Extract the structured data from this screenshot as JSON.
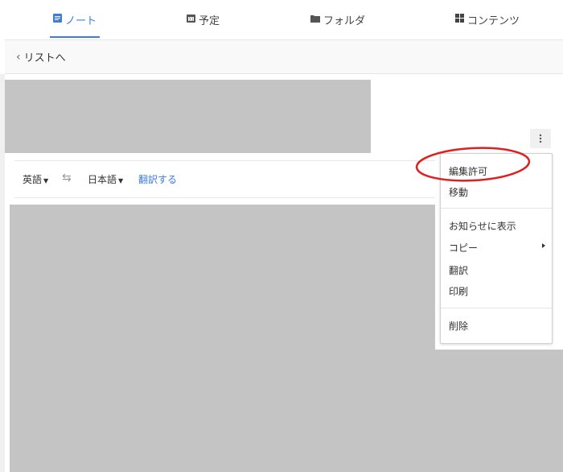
{
  "nav": {
    "tabs": [
      {
        "label": "ノート",
        "icon": "note-icon",
        "active": true
      },
      {
        "label": "予定",
        "icon": "calendar-icon",
        "active": false
      },
      {
        "label": "フォルダ",
        "icon": "folder-icon",
        "active": false
      },
      {
        "label": "コンテンツ",
        "icon": "grid-icon",
        "active": false
      }
    ]
  },
  "subbar": {
    "back_label": "リストへ"
  },
  "translate": {
    "source_lang": "英語",
    "target_lang": "日本語",
    "translate_label": "翻訳する"
  },
  "menu": {
    "items": [
      {
        "label": "編集許可"
      },
      {
        "label": "移動"
      },
      {
        "label": "お知らせに表示"
      },
      {
        "label": "コピー",
        "has_submenu": true
      },
      {
        "label": "翻訳"
      },
      {
        "label": "印刷"
      },
      {
        "label": "削除"
      }
    ]
  },
  "colors": {
    "accent": "#3d7be0",
    "annotation": "#e02020",
    "placeholder": "#c4c4c4"
  }
}
